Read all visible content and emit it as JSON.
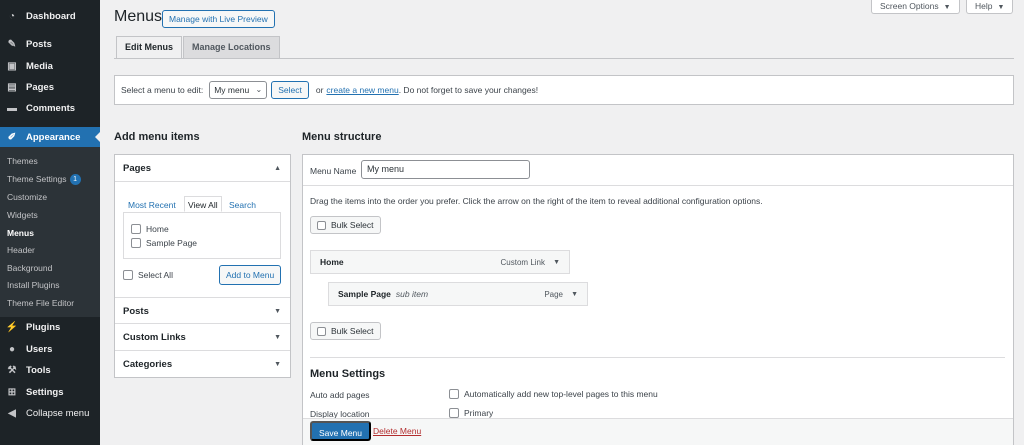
{
  "sidebar": {
    "items": [
      {
        "label": "Dashboard",
        "icon": "dashboard-icon"
      },
      {
        "label": "Posts",
        "icon": "pin-icon"
      },
      {
        "label": "Media",
        "icon": "media-icon"
      },
      {
        "label": "Pages",
        "icon": "pages-icon"
      },
      {
        "label": "Comments",
        "icon": "comment-icon"
      },
      {
        "label": "Appearance",
        "icon": "brush-icon"
      },
      {
        "label": "Plugins",
        "icon": "plugin-icon"
      },
      {
        "label": "Users",
        "icon": "users-icon"
      },
      {
        "label": "Tools",
        "icon": "wrench-icon"
      },
      {
        "label": "Settings",
        "icon": "settings-icon"
      },
      {
        "label": "Collapse menu",
        "icon": "collapse-icon"
      }
    ],
    "submenu": [
      {
        "label": "Themes"
      },
      {
        "label": "Theme Settings",
        "badge": "1"
      },
      {
        "label": "Customize"
      },
      {
        "label": "Widgets"
      },
      {
        "label": "Menus"
      },
      {
        "label": "Header"
      },
      {
        "label": "Background"
      },
      {
        "label": "Install Plugins"
      },
      {
        "label": "Theme File Editor"
      }
    ]
  },
  "header": {
    "title": "Menus",
    "live_preview": "Manage with Live Preview",
    "screen_options": "Screen Options",
    "help": "Help",
    "tabs": [
      "Edit Menus",
      "Manage Locations"
    ]
  },
  "select_bar": {
    "label": "Select a menu to edit:",
    "selected": "My menu",
    "select_button": "Select",
    "or_text": "or",
    "create_link": "create a new menu",
    "suffix": ". Do not forget to save your changes!"
  },
  "add_items": {
    "heading": "Add menu items",
    "sections": [
      "Pages",
      "Posts",
      "Custom Links",
      "Categories"
    ],
    "tabs": [
      "Most Recent",
      "View All",
      "Search"
    ],
    "pages": [
      "Home",
      "Sample Page"
    ],
    "select_all": "Select All",
    "add_button": "Add to Menu"
  },
  "structure": {
    "heading": "Menu structure",
    "name_label": "Menu Name",
    "name_value": "My menu",
    "instructions": "Drag the items into the order you prefer. Click the arrow on the right of the item to reveal additional configuration options.",
    "bulk_select": "Bulk Select",
    "items": [
      {
        "title": "Home",
        "sub": "",
        "type": "Custom Link"
      },
      {
        "title": "Sample Page",
        "sub": "sub item",
        "type": "Page"
      }
    ]
  },
  "settings": {
    "heading": "Menu Settings",
    "auto_add_label": "Auto add pages",
    "auto_add_option": "Automatically add new top-level pages to this menu",
    "display_label": "Display location",
    "display_option": "Primary",
    "save_button": "Save Menu",
    "delete_link": "Delete Menu"
  },
  "colors": {
    "accent": "#2271b1",
    "sidebar": "#1d2327",
    "danger": "#b32d2e"
  }
}
